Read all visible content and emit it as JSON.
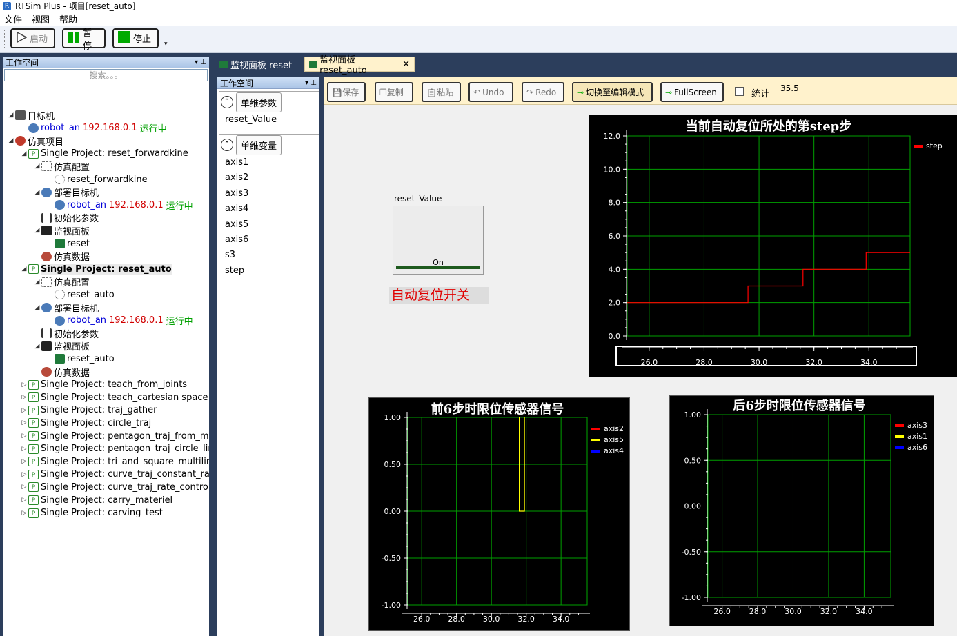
{
  "app": {
    "title": "RTSim Plus - 项目[reset_auto]"
  },
  "menu": [
    "文件",
    "视图",
    "帮助"
  ],
  "toolbar": {
    "start": "启动",
    "pause": "暂停",
    "stop": "停止"
  },
  "workspace": {
    "header": "工作空间",
    "search_placeholder": "搜索。。。",
    "tree": [
      {
        "depth": 0,
        "arrow": "open",
        "icon": "target-machine-icon",
        "text": "目标机"
      },
      {
        "depth": 1,
        "arrow": "none",
        "icon": "robot-icon",
        "text": "robot_an",
        "ip": "192.168.0.1",
        "status": "运行中"
      },
      {
        "depth": 0,
        "arrow": "open",
        "icon": "sim-project-icon",
        "text": "仿真项目"
      },
      {
        "depth": 1,
        "arrow": "open",
        "icon": "project-icon",
        "text": "Single Project: reset_forwardkine"
      },
      {
        "depth": 2,
        "arrow": "open",
        "icon": "gear-icon",
        "text": "仿真配置"
      },
      {
        "depth": 3,
        "arrow": "none",
        "icon": "config-icon",
        "text": "reset_forwardkine"
      },
      {
        "depth": 2,
        "arrow": "open",
        "icon": "deploy-icon",
        "text": "部署目标机"
      },
      {
        "depth": 3,
        "arrow": "none",
        "icon": "robot-icon",
        "text": "robot_an",
        "ip": "192.168.0.1",
        "status": "运行中"
      },
      {
        "depth": 2,
        "arrow": "none",
        "icon": "sliders-icon",
        "text": "初始化参数"
      },
      {
        "depth": 2,
        "arrow": "open",
        "icon": "monitor-icon",
        "text": "监视面板"
      },
      {
        "depth": 3,
        "arrow": "none",
        "icon": "panel-icon",
        "text": "reset"
      },
      {
        "depth": 2,
        "arrow": "none",
        "icon": "data-icon",
        "text": "仿真数据"
      },
      {
        "depth": 1,
        "arrow": "open",
        "icon": "project-icon",
        "text": "Single Project: reset_auto",
        "bold": true
      },
      {
        "depth": 2,
        "arrow": "open",
        "icon": "gear-icon",
        "text": "仿真配置"
      },
      {
        "depth": 3,
        "arrow": "none",
        "icon": "config-icon",
        "text": "reset_auto"
      },
      {
        "depth": 2,
        "arrow": "open",
        "icon": "deploy-icon",
        "text": "部署目标机"
      },
      {
        "depth": 3,
        "arrow": "none",
        "icon": "robot-icon",
        "text": "robot_an",
        "ip": "192.168.0.1",
        "status": "运行中"
      },
      {
        "depth": 2,
        "arrow": "none",
        "icon": "sliders-icon",
        "text": "初始化参数"
      },
      {
        "depth": 2,
        "arrow": "open",
        "icon": "monitor-icon",
        "text": "监视面板"
      },
      {
        "depth": 3,
        "arrow": "none",
        "icon": "panel-icon",
        "text": "reset_auto"
      },
      {
        "depth": 2,
        "arrow": "none",
        "icon": "data-icon",
        "text": "仿真数据"
      },
      {
        "depth": 1,
        "arrow": "closed",
        "icon": "project-icon",
        "text": "Single Project: teach_from_joints"
      },
      {
        "depth": 1,
        "arrow": "closed",
        "icon": "project-icon",
        "text": "Single Project: teach_cartesian space"
      },
      {
        "depth": 1,
        "arrow": "closed",
        "icon": "project-icon",
        "text": "Single Project: traj_gather"
      },
      {
        "depth": 1,
        "arrow": "closed",
        "icon": "project-icon",
        "text": "Single Project: circle_traj"
      },
      {
        "depth": 1,
        "arrow": "closed",
        "icon": "project-icon",
        "text": "Single Project: pentagon_traj_from_mu"
      },
      {
        "depth": 1,
        "arrow": "closed",
        "icon": "project-icon",
        "text": "Single Project: pentagon_traj_circle_lin"
      },
      {
        "depth": 1,
        "arrow": "closed",
        "icon": "project-icon",
        "text": "Single Project: tri_and_square_multiline"
      },
      {
        "depth": 1,
        "arrow": "closed",
        "icon": "project-icon",
        "text": "Single Project: curve_traj_constant_rate"
      },
      {
        "depth": 1,
        "arrow": "closed",
        "icon": "project-icon",
        "text": "Single Project: curve_traj_rate_control_"
      },
      {
        "depth": 1,
        "arrow": "closed",
        "icon": "project-icon",
        "text": "Single Project: carry_materiel"
      },
      {
        "depth": 1,
        "arrow": "closed",
        "icon": "project-icon",
        "text": "Single Project: carving_test"
      }
    ]
  },
  "varpanel": {
    "header": "工作空间",
    "params_button": "单维参数",
    "params": [
      "reset_Value"
    ],
    "vars_button": "单维变量",
    "vars": [
      "axis1",
      "axis2",
      "axis3",
      "axis4",
      "axis5",
      "axis6",
      "s3",
      "step"
    ]
  },
  "tabs": [
    {
      "label": "监视面板 reset",
      "active": false
    },
    {
      "label": "监视面板 reset_auto",
      "active": true
    }
  ],
  "panel_toolbar": {
    "save": "保存",
    "copy": "复制",
    "paste": "粘贴",
    "undo": "Undo",
    "redo": "Redo",
    "switch_mode": "切换至编辑模式",
    "fullscreen": "FullScreen",
    "stats": "统计",
    "stats_value": "35.5"
  },
  "switch": {
    "label": "reset_Value",
    "state": "On"
  },
  "auto_reset_label": "自动复位开关",
  "colors": {
    "red": "#ff0000",
    "yellow": "#ffff00",
    "blue": "#0000ff",
    "grid": "#00a000",
    "accent_toolbar": "#fff2cc"
  },
  "chart_data": [
    {
      "type": "line",
      "title": "当前自动复位所处的第step步",
      "ylim": [
        0,
        12
      ],
      "xlim": [
        25.2,
        35.5
      ],
      "yticks": [
        "12.0",
        "10.0",
        "8.0",
        "6.0",
        "4.0",
        "2.0",
        "0.0"
      ],
      "xticks": [
        "26.0",
        "28.0",
        "30.0",
        "32.0",
        "34.0"
      ],
      "series": [
        {
          "name": "step",
          "color": "#ff0000",
          "points": [
            [
              25.2,
              2
            ],
            [
              29.6,
              2
            ],
            [
              29.6,
              3
            ],
            [
              31.6,
              3
            ],
            [
              31.6,
              4
            ],
            [
              33.9,
              4
            ],
            [
              33.9,
              5
            ],
            [
              35.5,
              5
            ]
          ]
        }
      ]
    },
    {
      "type": "line",
      "title": "前6步时限位传感器信号",
      "ylim": [
        -1,
        1
      ],
      "xlim": [
        25.2,
        35.5
      ],
      "yticks": [
        "1.00",
        "0.50",
        "0.00",
        "-0.50",
        "-1.00"
      ],
      "xticks": [
        "26.0",
        "28.0",
        "30.0",
        "32.0",
        "34.0"
      ],
      "series": [
        {
          "name": "axis2",
          "color": "#ff0000",
          "points": []
        },
        {
          "name": "axis5",
          "color": "#ffff00",
          "points": [
            [
              31.6,
              1
            ],
            [
              31.6,
              0
            ],
            [
              31.9,
              0
            ],
            [
              31.9,
              1
            ]
          ]
        },
        {
          "name": "axis4",
          "color": "#0000ff",
          "points": []
        }
      ]
    },
    {
      "type": "line",
      "title": "后6步时限位传感器信号",
      "ylim": [
        -1,
        1
      ],
      "xlim": [
        25.2,
        35.5
      ],
      "yticks": [
        "1.00",
        "0.50",
        "0.00",
        "-0.50",
        "-1.00"
      ],
      "xticks": [
        "26.0",
        "28.0",
        "30.0",
        "32.0",
        "34.0"
      ],
      "series": [
        {
          "name": "axis3",
          "color": "#ff0000",
          "points": []
        },
        {
          "name": "axis1",
          "color": "#ffff00",
          "points": []
        },
        {
          "name": "axis6",
          "color": "#0000ff",
          "points": []
        }
      ]
    }
  ]
}
